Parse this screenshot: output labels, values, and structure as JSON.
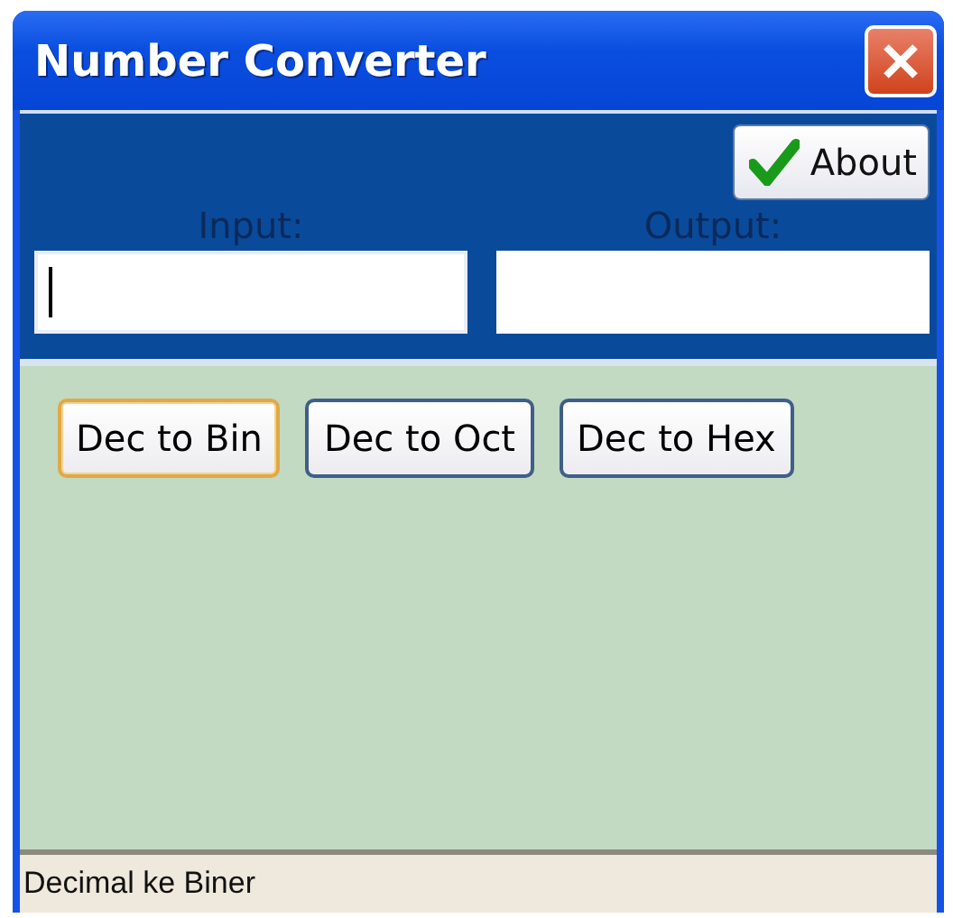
{
  "window": {
    "title": "Number Converter"
  },
  "about_button": {
    "label": "About"
  },
  "fields": [
    {
      "label": "Input:",
      "focused": true
    },
    {
      "label": "Output:",
      "focused": false
    }
  ],
  "buttons": [
    {
      "label": "Dec to Bin",
      "selected": true
    },
    {
      "label": "Dec to Oct",
      "selected": false
    },
    {
      "label": "Dec to Hex",
      "selected": false
    }
  ],
  "status_bar": "Decimal ke Biner"
}
